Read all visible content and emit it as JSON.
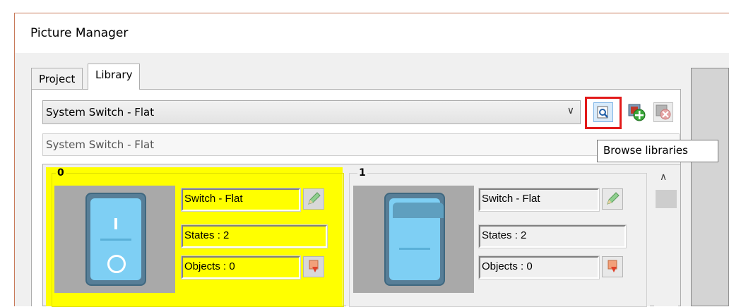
{
  "window": {
    "title": "Picture Manager"
  },
  "tabs": [
    {
      "label": "Project",
      "active": false
    },
    {
      "label": "Library",
      "active": true
    }
  ],
  "library_select": {
    "value": "System Switch - Flat"
  },
  "toolbar": {
    "browse_icon": "browse-magnifier-icon",
    "add_icon": "add-library-icon",
    "remove_icon": "remove-library-icon",
    "highlight_color": "#e21a1a"
  },
  "description": {
    "value": "System Switch - Flat"
  },
  "tooltip": {
    "text": "Browse libraries"
  },
  "items": [
    {
      "index": "0",
      "name": "Switch - Flat",
      "states": "States : 2",
      "objects": "Objects : 0",
      "selected": true,
      "bg": "#ffff00"
    },
    {
      "index": "1",
      "name": "Switch - Flat",
      "states": "States : 2",
      "objects": "Objects : 0",
      "selected": false,
      "bg": "#f0f0f0"
    }
  ],
  "scrollbar": {
    "up_icon": "chevron-up-icon"
  }
}
